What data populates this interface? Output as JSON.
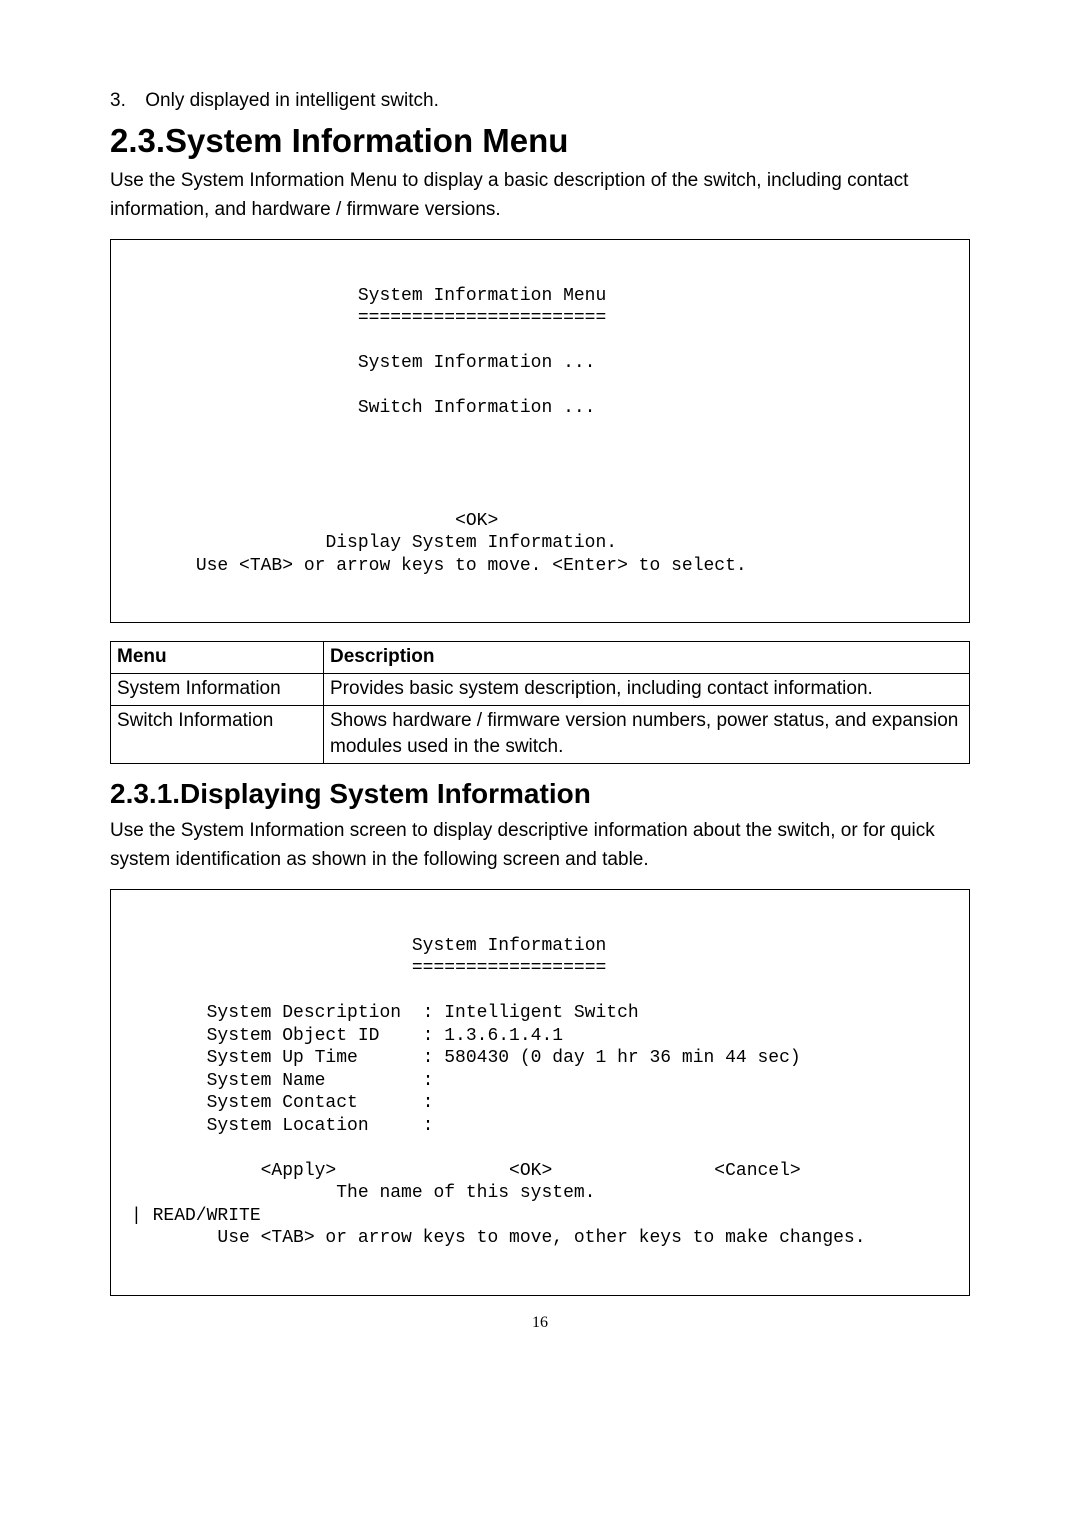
{
  "list_item": {
    "num": "3.",
    "text": "Only displayed in intelligent switch."
  },
  "heading_1": "2.3.System Information Menu",
  "intro_1": "Use the System Information Menu to display a basic description of the switch, including contact information, and hardware / firmware versions.",
  "term1": {
    "title": "System Information Menu",
    "divider": "=======================",
    "line1": "System Information ...",
    "line2": "Switch Information ...",
    "ok": "<OK>",
    "help": "Display System Information.",
    "nav": "Use <TAB> or arrow keys to move. <Enter> to select."
  },
  "table": {
    "headers": {
      "menu": "Menu",
      "desc": "Description"
    },
    "rows": [
      {
        "menu": "System Information",
        "desc": "Provides basic system description, including contact information."
      },
      {
        "menu": "Switch Information",
        "desc": "Shows hardware / firmware version numbers, power status, and expansion modules used in the switch."
      }
    ]
  },
  "heading_2": "2.3.1.Displaying System Information",
  "intro_2": "Use the System Information screen to display descriptive information about the switch, or for quick system identification as shown in the following screen and table.",
  "term2": {
    "title": "System Information",
    "div": "==================",
    "l1": "       System Description  : Intelligent Switch",
    "l2": "       System Object ID    : 1.3.6.1.4.1",
    "l3": "       System Up Time      : 580430 (0 day 1 hr 36 min 44 sec)",
    "l4": "       System Name         :",
    "l5": "       System Contact      :",
    "l6": "       System Location     :",
    "btns": "            <Apply>                <OK>               <Cancel>",
    "help": "                   The name of this system.",
    "rw": "| READ/WRITE",
    "nav": "        Use <TAB> or arrow keys to move, other keys to make changes."
  },
  "page_number": "16"
}
